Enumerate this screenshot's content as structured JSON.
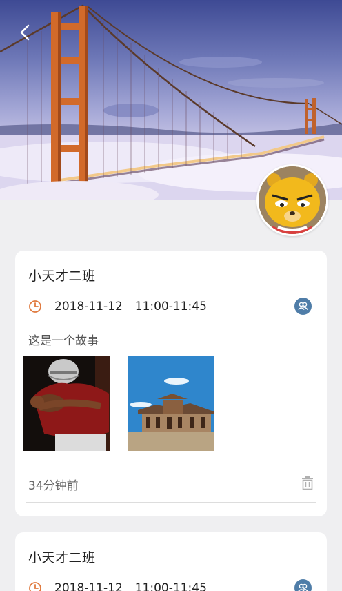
{
  "posts": [
    {
      "title": "小天才二班",
      "date": "2018-11-12",
      "time_range": "11:00-11:45",
      "text": "这是一个故事",
      "photos": [
        "football-player-photo",
        "temple-photo"
      ],
      "time_ago": "34分钟前"
    },
    {
      "title": "小天才二班",
      "date": "2018-11-12",
      "time_range": "11:00-11:45"
    }
  ],
  "icons": {
    "back": "chevron-left-icon",
    "clock": "clock-icon",
    "members": "group-icon",
    "delete": "trash-icon"
  },
  "colors": {
    "page_background": "#efeff1",
    "clock_accent": "#e07a3f",
    "members_badge": "#4f7da8"
  }
}
